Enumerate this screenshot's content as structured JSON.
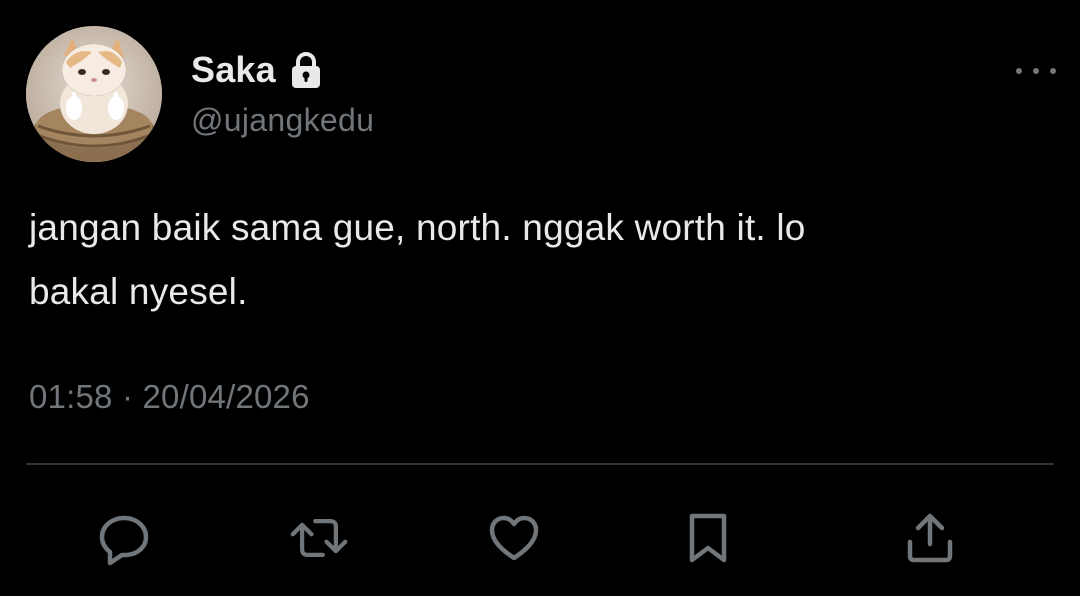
{
  "user": {
    "display_name": "Saka",
    "handle": "@ujangkedu",
    "avatar_icon": "cat-avatar",
    "protected_icon": "lock-icon"
  },
  "tweet": {
    "text": "jangan baik sama gue, north. nggak worth it. lo\nbakal nyesel.",
    "timestamp": "01:58 · 20/04/2026"
  },
  "actions": [
    {
      "name": "reply",
      "icon": "reply-icon"
    },
    {
      "name": "retweet",
      "icon": "retweet-icon"
    },
    {
      "name": "like",
      "icon": "heart-icon"
    },
    {
      "name": "bookmark",
      "icon": "bookmark-icon"
    },
    {
      "name": "share",
      "icon": "share-icon"
    }
  ],
  "colors": {
    "background": "#000000",
    "primary_text": "#e7e9ea",
    "secondary_text": "#71767b",
    "divider": "#2f3336"
  }
}
